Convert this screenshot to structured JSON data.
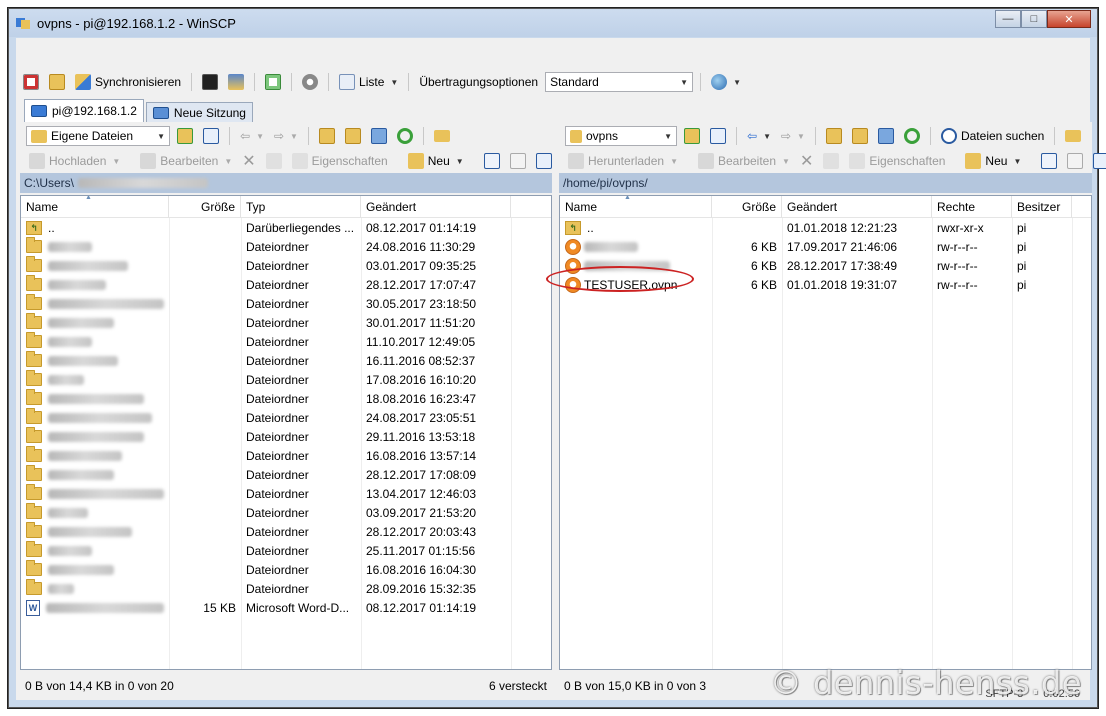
{
  "window": {
    "title": "ovpns - pi@192.168.1.2 - WinSCP",
    "controls": [
      "minimize",
      "maximize",
      "close"
    ]
  },
  "main_toolbar": {
    "synchronize_label": "Synchronisieren",
    "list_label": "Liste",
    "transfer_options_label": "Übertragungsoptionen",
    "transfer_preset": "Standard"
  },
  "tabs": [
    {
      "label": "pi@192.168.1.2",
      "active": true
    },
    {
      "label": "Neue Sitzung",
      "active": false
    }
  ],
  "left_panel": {
    "location": "Eigene Dateien",
    "actions": {
      "upload": "Hochladen",
      "edit": "Bearbeiten",
      "properties": "Eigenschaften",
      "new": "Neu"
    },
    "path": "C:\\Users\\",
    "columns": [
      "Name",
      "Größe",
      "Typ",
      "Geändert"
    ],
    "rows": [
      {
        "icon": "parent-dir-icon",
        "name": "..",
        "size": "",
        "type": "Darüberliegendes ...",
        "modified": "08.12.2017  01:14:19"
      },
      {
        "icon": "folder-icon",
        "name": "",
        "size": "",
        "type": "Dateiordner",
        "modified": "24.08.2016  11:30:29"
      },
      {
        "icon": "folder-icon",
        "name": "",
        "size": "",
        "type": "Dateiordner",
        "modified": "03.01.2017  09:35:25"
      },
      {
        "icon": "folder-icon",
        "name": "",
        "size": "",
        "type": "Dateiordner",
        "modified": "28.12.2017  17:07:47"
      },
      {
        "icon": "folder-icon",
        "name": "",
        "size": "",
        "type": "Dateiordner",
        "modified": "30.05.2017  23:18:50"
      },
      {
        "icon": "folder-icon",
        "name": "",
        "size": "",
        "type": "Dateiordner",
        "modified": "30.01.2017  11:51:20"
      },
      {
        "icon": "folder-icon",
        "name": "",
        "size": "",
        "type": "Dateiordner",
        "modified": "11.10.2017  12:49:05"
      },
      {
        "icon": "folder-icon",
        "name": "",
        "size": "",
        "type": "Dateiordner",
        "modified": "16.11.2016  08:52:37"
      },
      {
        "icon": "folder-icon",
        "name": "",
        "size": "",
        "type": "Dateiordner",
        "modified": "17.08.2016  16:10:20"
      },
      {
        "icon": "folder-icon",
        "name": "",
        "size": "",
        "type": "Dateiordner",
        "modified": "18.08.2016  16:23:47"
      },
      {
        "icon": "folder-icon",
        "name": "",
        "size": "",
        "type": "Dateiordner",
        "modified": "24.08.2017  23:05:51"
      },
      {
        "icon": "folder-icon",
        "name": "",
        "size": "",
        "type": "Dateiordner",
        "modified": "29.11.2016  13:53:18"
      },
      {
        "icon": "folder-icon",
        "name": "",
        "size": "",
        "type": "Dateiordner",
        "modified": "16.08.2016  13:57:14"
      },
      {
        "icon": "folder-icon",
        "name": "",
        "size": "",
        "type": "Dateiordner",
        "modified": "28.12.2017  17:08:09"
      },
      {
        "icon": "folder-icon",
        "name": "",
        "size": "",
        "type": "Dateiordner",
        "modified": "13.04.2017  12:46:03"
      },
      {
        "icon": "folder-icon",
        "name": "",
        "size": "",
        "type": "Dateiordner",
        "modified": "03.09.2017  21:53:20"
      },
      {
        "icon": "folder-icon",
        "name": "",
        "size": "",
        "type": "Dateiordner",
        "modified": "28.12.2017  20:03:43"
      },
      {
        "icon": "folder-icon",
        "name": "",
        "size": "",
        "type": "Dateiordner",
        "modified": "25.11.2017  01:15:56"
      },
      {
        "icon": "folder-icon",
        "name": "",
        "size": "",
        "type": "Dateiordner",
        "modified": "16.08.2016  16:04:30"
      },
      {
        "icon": "folder-icon",
        "name": "",
        "size": "",
        "type": "Dateiordner",
        "modified": "28.09.2016  15:32:35"
      },
      {
        "icon": "word-doc-icon",
        "name": "",
        "size": "15 KB",
        "type": "Microsoft Word-D...",
        "modified": "08.12.2017  01:14:19"
      }
    ],
    "status": "0 B von 14,4 KB in 0 von 20",
    "hidden": "6 versteckt"
  },
  "right_panel": {
    "location": "ovpns",
    "find_files_label": "Dateien suchen",
    "actions": {
      "download": "Herunterladen",
      "edit": "Bearbeiten",
      "properties": "Eigenschaften",
      "new": "Neu"
    },
    "path": "/home/pi/ovpns/",
    "columns": [
      "Name",
      "Größe",
      "Geändert",
      "Rechte",
      "Besitzer"
    ],
    "rows": [
      {
        "icon": "parent-dir-icon",
        "name": "..",
        "size": "",
        "modified": "01.01.2018 12:21:23",
        "rights": "rwxr-xr-x",
        "owner": "pi"
      },
      {
        "icon": "ovpn-file-icon",
        "name": "",
        "size": "6 KB",
        "modified": "17.09.2017 21:46:06",
        "rights": "rw-r--r--",
        "owner": "pi"
      },
      {
        "icon": "ovpn-file-icon",
        "name": "",
        "size": "6 KB",
        "modified": "28.12.2017 17:38:49",
        "rights": "rw-r--r--",
        "owner": "pi"
      },
      {
        "icon": "ovpn-file-icon",
        "name": "TESTUSER.ovpn",
        "size": "6 KB",
        "modified": "01.01.2018 19:31:07",
        "rights": "rw-r--r--",
        "owner": "pi"
      }
    ],
    "status": "0 B von 15,0 KB in 0 von 3"
  },
  "status_extra": {
    "protocol": "SFTP-3",
    "time": "0:02:56"
  },
  "watermark": "© dennis-henss.de",
  "colors": {
    "accent": "#b4c6dd",
    "highlight_circle": "#cc2222",
    "folder": "#e9c25a"
  }
}
